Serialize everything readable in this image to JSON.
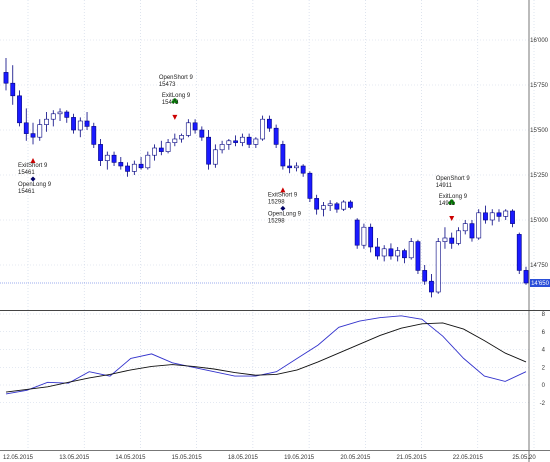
{
  "chart_data": [
    {
      "type": "candlestick",
      "panel": "price",
      "ylim": [
        14600,
        16100
      ],
      "y_ticks": [
        "16'000",
        "15'750",
        "15'500",
        "15'250",
        "15'000",
        "14'750"
      ],
      "y_tick_values": [
        16000,
        15750,
        15500,
        15250,
        15000,
        14750
      ],
      "last_price_label": "14'650",
      "last_price": 14650,
      "grid": true,
      "colors": {
        "bull_body": "#ffffff",
        "bear_body": "#1a1aff",
        "wick": "#000080",
        "grid": "#c9d3e4",
        "price_line": "#3b5bdb",
        "price_label_bg": "#2b4fd8"
      },
      "candles": [
        {
          "o": 15820,
          "h": 15900,
          "l": 15720,
          "c": 15760
        },
        {
          "o": 15760,
          "h": 15860,
          "l": 15640,
          "c": 15690
        },
        {
          "o": 15690,
          "h": 15720,
          "l": 15520,
          "c": 15540
        },
        {
          "o": 15540,
          "h": 15620,
          "l": 15440,
          "c": 15480
        },
        {
          "o": 15480,
          "h": 15540,
          "l": 15420,
          "c": 15460
        },
        {
          "o": 15460,
          "h": 15560,
          "l": 15440,
          "c": 15530
        },
        {
          "o": 15530,
          "h": 15600,
          "l": 15490,
          "c": 15560
        },
        {
          "o": 15560,
          "h": 15610,
          "l": 15520,
          "c": 15590
        },
        {
          "o": 15590,
          "h": 15620,
          "l": 15550,
          "c": 15600
        },
        {
          "o": 15600,
          "h": 15610,
          "l": 15540,
          "c": 15570
        },
        {
          "o": 15570,
          "h": 15590,
          "l": 15480,
          "c": 15500
        },
        {
          "o": 15500,
          "h": 15570,
          "l": 15460,
          "c": 15550
        },
        {
          "o": 15550,
          "h": 15600,
          "l": 15500,
          "c": 15520
        },
        {
          "o": 15520,
          "h": 15540,
          "l": 15400,
          "c": 15420
        },
        {
          "o": 15420,
          "h": 15450,
          "l": 15300,
          "c": 15330
        },
        {
          "o": 15330,
          "h": 15380,
          "l": 15280,
          "c": 15360
        },
        {
          "o": 15360,
          "h": 15380,
          "l": 15300,
          "c": 15320
        },
        {
          "o": 15320,
          "h": 15350,
          "l": 15280,
          "c": 15300
        },
        {
          "o": 15300,
          "h": 15320,
          "l": 15240,
          "c": 15270
        },
        {
          "o": 15270,
          "h": 15330,
          "l": 15250,
          "c": 15310
        },
        {
          "o": 15310,
          "h": 15350,
          "l": 15280,
          "c": 15290
        },
        {
          "o": 15290,
          "h": 15380,
          "l": 15280,
          "c": 15360
        },
        {
          "o": 15360,
          "h": 15420,
          "l": 15330,
          "c": 15400
        },
        {
          "o": 15400,
          "h": 15440,
          "l": 15360,
          "c": 15380
        },
        {
          "o": 15380,
          "h": 15450,
          "l": 15370,
          "c": 15430
        },
        {
          "o": 15430,
          "h": 15480,
          "l": 15410,
          "c": 15450
        },
        {
          "o": 15450,
          "h": 15480,
          "l": 15430,
          "c": 15470
        },
        {
          "o": 15470,
          "h": 15560,
          "l": 15460,
          "c": 15540
        },
        {
          "o": 15540,
          "h": 15560,
          "l": 15480,
          "c": 15500
        },
        {
          "o": 15500,
          "h": 15520,
          "l": 15440,
          "c": 15460
        },
        {
          "o": 15460,
          "h": 15500,
          "l": 15280,
          "c": 15310
        },
        {
          "o": 15310,
          "h": 15420,
          "l": 15290,
          "c": 15390
        },
        {
          "o": 15390,
          "h": 15440,
          "l": 15370,
          "c": 15420
        },
        {
          "o": 15420,
          "h": 15450,
          "l": 15390,
          "c": 15440
        },
        {
          "o": 15440,
          "h": 15470,
          "l": 15410,
          "c": 15430
        },
        {
          "o": 15430,
          "h": 15480,
          "l": 15410,
          "c": 15460
        },
        {
          "o": 15460,
          "h": 15480,
          "l": 15400,
          "c": 15420
        },
        {
          "o": 15420,
          "h": 15460,
          "l": 15400,
          "c": 15450
        },
        {
          "o": 15450,
          "h": 15580,
          "l": 15440,
          "c": 15560
        },
        {
          "o": 15560,
          "h": 15580,
          "l": 15490,
          "c": 15510
        },
        {
          "o": 15510,
          "h": 15530,
          "l": 15400,
          "c": 15420
        },
        {
          "o": 15420,
          "h": 15440,
          "l": 15280,
          "c": 15300
        },
        {
          "o": 15300,
          "h": 15340,
          "l": 15260,
          "c": 15290
        },
        {
          "o": 15290,
          "h": 15320,
          "l": 15270,
          "c": 15300
        },
        {
          "o": 15300,
          "h": 15310,
          "l": 15240,
          "c": 15260
        },
        {
          "o": 15260,
          "h": 15270,
          "l": 15100,
          "c": 15120
        },
        {
          "o": 15120,
          "h": 15140,
          "l": 15030,
          "c": 15060
        },
        {
          "o": 15060,
          "h": 15100,
          "l": 15020,
          "c": 15080
        },
        {
          "o": 15080,
          "h": 15110,
          "l": 15050,
          "c": 15090
        },
        {
          "o": 15090,
          "h": 15100,
          "l": 15040,
          "c": 15060
        },
        {
          "o": 15060,
          "h": 15110,
          "l": 15050,
          "c": 15100
        },
        {
          "o": 15100,
          "h": 15110,
          "l": 15060,
          "c": 15070
        },
        {
          "o": 15000,
          "h": 15010,
          "l": 14840,
          "c": 14860
        },
        {
          "o": 14860,
          "h": 14980,
          "l": 14840,
          "c": 14960
        },
        {
          "o": 14960,
          "h": 14980,
          "l": 14820,
          "c": 14850
        },
        {
          "o": 14850,
          "h": 14900,
          "l": 14780,
          "c": 14800
        },
        {
          "o": 14800,
          "h": 14860,
          "l": 14770,
          "c": 14840
        },
        {
          "o": 14840,
          "h": 14870,
          "l": 14780,
          "c": 14800
        },
        {
          "o": 14800,
          "h": 14850,
          "l": 14770,
          "c": 14830
        },
        {
          "o": 14830,
          "h": 14840,
          "l": 14760,
          "c": 14790
        },
        {
          "o": 14790,
          "h": 14900,
          "l": 14780,
          "c": 14880
        },
        {
          "o": 14880,
          "h": 14890,
          "l": 14700,
          "c": 14720
        },
        {
          "o": 14720,
          "h": 14750,
          "l": 14640,
          "c": 14660
        },
        {
          "o": 14660,
          "h": 14700,
          "l": 14570,
          "c": 14600
        },
        {
          "o": 14600,
          "h": 14900,
          "l": 14590,
          "c": 14880
        },
        {
          "o": 14880,
          "h": 14960,
          "l": 14840,
          "c": 14900
        },
        {
          "o": 14900,
          "h": 14930,
          "l": 14840,
          "c": 14870
        },
        {
          "o": 14870,
          "h": 14960,
          "l": 14860,
          "c": 14940
        },
        {
          "o": 14940,
          "h": 15000,
          "l": 14920,
          "c": 14980
        },
        {
          "o": 14980,
          "h": 15000,
          "l": 14880,
          "c": 14900
        },
        {
          "o": 14900,
          "h": 15060,
          "l": 14890,
          "c": 15040
        },
        {
          "o": 15040,
          "h": 15080,
          "l": 14980,
          "c": 15000
        },
        {
          "o": 15000,
          "h": 15060,
          "l": 14970,
          "c": 15040
        },
        {
          "o": 15040,
          "h": 15060,
          "l": 14990,
          "c": 15020
        },
        {
          "o": 15020,
          "h": 15060,
          "l": 15000,
          "c": 15050
        },
        {
          "o": 15050,
          "h": 15060,
          "l": 14960,
          "c": 14980
        },
        {
          "o": 14920,
          "h": 14930,
          "l": 14700,
          "c": 14720
        },
        {
          "o": 14720,
          "h": 14740,
          "l": 14640,
          "c": 14650
        }
      ],
      "annotations": [
        {
          "lines": [
            "ExitShort 9",
            "15461"
          ],
          "marker": "up-triangle",
          "marker_color": "#cc0000",
          "bar": 4,
          "price": 15461,
          "side": "below"
        },
        {
          "lines": [
            "OpenLong 9",
            "15461"
          ],
          "marker": "diamond",
          "marker_color": "#000066",
          "bar": 4,
          "price": 15461,
          "side": "below2"
        },
        {
          "lines": [
            "OpenShort 9",
            "15473"
          ],
          "marker": "club",
          "marker_color": "#008000",
          "bar": 25,
          "price": 15473,
          "side": "above2"
        },
        {
          "lines": [
            "ExitLong 9",
            "15473"
          ],
          "marker": "down-triangle",
          "marker_color": "#cc0000",
          "bar": 25,
          "price": 15473,
          "side": "above"
        },
        {
          "lines": [
            "ExitShort 9",
            "15298"
          ],
          "marker": "up-triangle",
          "marker_color": "#cc0000",
          "bar": 41,
          "price": 15298,
          "side": "below"
        },
        {
          "lines": [
            "OpenLong 9",
            "15298"
          ],
          "marker": "diamond",
          "marker_color": "#000066",
          "bar": 41,
          "price": 15298,
          "side": "below2"
        },
        {
          "lines": [
            "OpenShort 9",
            "14911"
          ],
          "marker": "club",
          "marker_color": "#008000",
          "bar": 66,
          "price": 14911,
          "side": "above2"
        },
        {
          "lines": [
            "ExitLong 9",
            "14911"
          ],
          "marker": "down-triangle",
          "marker_color": "#cc0000",
          "bar": 66,
          "price": 14911,
          "side": "above"
        }
      ]
    },
    {
      "type": "line",
      "panel": "oscillator",
      "ylim": [
        -2.6,
        9
      ],
      "y_ticks": [
        "8",
        "6",
        "4",
        "2",
        "0",
        "-2"
      ],
      "y_tick_values": [
        8,
        6,
        4,
        2,
        0,
        -2
      ],
      "grid": true,
      "x_labels": [
        "12.05.2015",
        "13.05.2015",
        "14.05.2015",
        "15.05.2015",
        "18.05.2015",
        "19.05.2015",
        "20.05.2015",
        "21.05.2015",
        "22.05.2015",
        "25.05.20"
      ],
      "series": [
        {
          "color": "#3333cc",
          "values": [
            -1.0,
            -0.6,
            0.3,
            0.2,
            1.5,
            1.0,
            3.0,
            3.5,
            2.5,
            2.0,
            1.5,
            1.0,
            1.0,
            1.5,
            3.0,
            4.5,
            6.5,
            7.2,
            7.6,
            7.8,
            7.4,
            5.5,
            3.0,
            1.0,
            0.4,
            1.5
          ]
        },
        {
          "color": "#111111",
          "values": [
            -0.8,
            -0.5,
            -0.2,
            0.3,
            0.8,
            1.2,
            1.7,
            2.1,
            2.3,
            2.1,
            1.8,
            1.4,
            1.1,
            1.2,
            1.7,
            2.6,
            3.6,
            4.6,
            5.6,
            6.4,
            6.9,
            7.0,
            6.3,
            5.0,
            3.6,
            2.6
          ]
        }
      ]
    }
  ]
}
